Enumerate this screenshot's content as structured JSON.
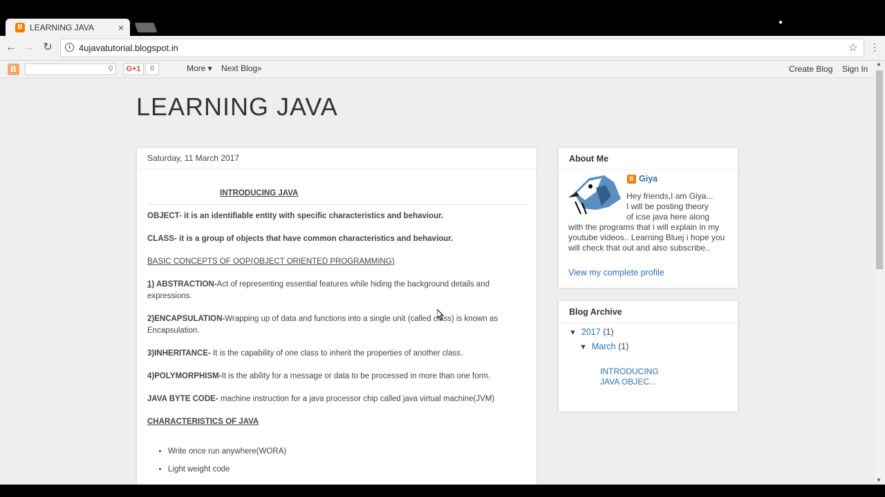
{
  "browser": {
    "tab_title": "LEARNING JAVA",
    "tab_close": "×",
    "url": "4ujavatutorial.blogspot.in"
  },
  "blogger_nav": {
    "gplus": "G+1",
    "gplus_count": "0",
    "more": "More ▾",
    "next_blog": "Next Blog»",
    "create_blog": "Create Blog",
    "sign_in": "Sign In"
  },
  "blog": {
    "title": "LEARNING JAVA"
  },
  "post": {
    "date": "Saturday, 11 March 2017",
    "heading": "INTRODUCING JAVA",
    "object_label": "OBJECT-",
    "object_text": " it is an identifiable entity with specific characteristics and behaviour.",
    "class_label": "CLASS-",
    "class_text": " it is a group of objects that have common characteristics and behaviour.",
    "oop_heading": "BASIC CONCEPTS OF OOP(OBJECT ORIENTED PROGRAMMING)",
    "c1_num": "1)",
    "c1_label": " ABSTRACTION-",
    "c1_text": "Act of representing essential features while hiding the background details and expressions.",
    "c2_label": "2)ENCAPSULATION-",
    "c2_text": "Wrapping up of data and functions into a single unit (called class) is known as Encapsulation.",
    "c3_label": "3)INHERITANCE-",
    "c3_text": " It is the capability of one class to inherit the properties of another class.",
    "c4_label": "4)POLYMORPHISM-",
    "c4_text": "It is the ability for a message or data to be processed in more than one form.",
    "bytecode_label": "JAVA BYTE CODE-",
    "bytecode_text": " machine instruction for a java processor chip called java virtual machine(JVM)",
    "char_heading": "CHARACTERISTICS OF JAVA",
    "features": [
      "Write once run anywhere(WORA)",
      "Light weight code"
    ]
  },
  "about_me": {
    "title": "About Me",
    "name": "Giya",
    "text_line1": "Hey friends,I am Giya...",
    "text_line2": "I will be posting theory",
    "text_line3": "of icse java here along",
    "text_rest": "with the programs that i will explain in my youtube videos.. Learning Bluej i hope you will check that out and also subscribe..",
    "view_profile": "View my complete profile"
  },
  "archive": {
    "title": "Blog Archive",
    "year": "2017",
    "year_count": "(1)",
    "month": "March",
    "month_count": "(1)",
    "post_title": "INTRODUCING JAVA OBJEC..."
  }
}
